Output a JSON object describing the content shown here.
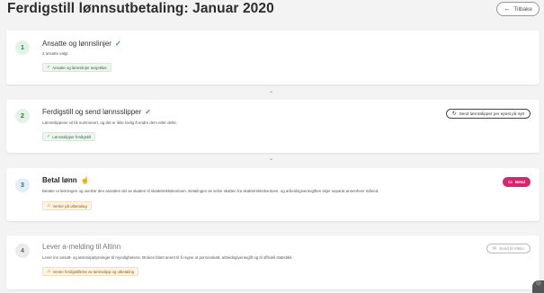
{
  "header": {
    "title": "Ferdigstill lønnsutbetaling: Januar 2020",
    "back_label": "Tilbake",
    "back_icon": "arrow-left-icon"
  },
  "steps": [
    {
      "number": "1",
      "title": "Ansatte og lønnslinjer",
      "status": "done",
      "description": "2 ansatte valgt",
      "badge": "Ansatte og lønnslinjer avsjekket",
      "badge_type": "ok"
    },
    {
      "number": "2",
      "title": "Ferdigstill og send lønnsslipper",
      "status": "done",
      "description": "Lønnsslippene vil bli nummerert, og det er ikke lovlig å endre dem etter dette.",
      "badge": "Lønnsslipper ferdigstilt",
      "badge_type": "ok",
      "action": "Send lønnsslipper per epost på nytt"
    },
    {
      "number": "3",
      "title": "Betal lønn",
      "status": "active",
      "description": "Betaler ut lønningen og overfør den ansattes del av skatten til skattetrekkskontoen. Betalingen av selve skatten fra skattetrekkskontoen, og arbeidsgiveravgiften skjer separat annenhver måned.",
      "badge": "Venter på utbetaling",
      "badge_type": "warn",
      "action": "Betal"
    },
    {
      "number": "4",
      "title": "Lever a-melding til Altinn",
      "status": "pending",
      "description": "Lever inn ansatt- og lønnsopplysninger til myndighetene. Brukes blant annet til å regne ut personskatt, arbeidsgiveravgift og til offisiell statistikk.",
      "badge": "Venter ferdigstillelse av lønnsslipp og utbetaling",
      "badge_type": "warn",
      "action": "Send til Altinn"
    }
  ],
  "colors": {
    "background": "#f3f3f3",
    "primary_pink": "#d6266e",
    "success_green": "#2e9a4a",
    "active_blue": "#2a5fa5"
  }
}
